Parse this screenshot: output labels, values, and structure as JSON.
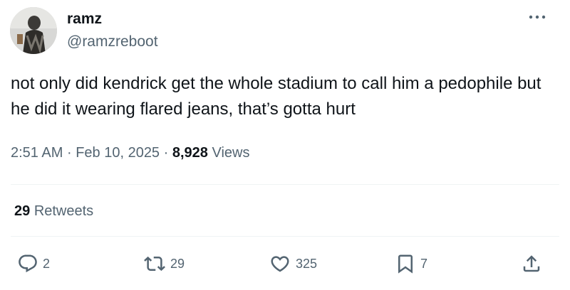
{
  "author": {
    "display_name": "ramz",
    "handle": "@ramzreboot",
    "avatar_icon": "profile-photo"
  },
  "tweet": {
    "text": "not only did kendrick get the whole stadium to call him a pedophile but he did it wearing flared jeans, that’s gotta hurt",
    "time": "2:51 AM",
    "separator": "·",
    "date": "Feb 10, 2025",
    "views_count": "8,928",
    "views_label": "Views"
  },
  "engagement": {
    "retweets_count": "29",
    "retweets_label": "Retweets"
  },
  "actions": {
    "replies": "2",
    "retweets": "29",
    "likes": "325",
    "bookmarks": "7"
  },
  "colors": {
    "primary_text": "#0f1419",
    "secondary_text": "#536471",
    "divider": "#eff3f4"
  }
}
